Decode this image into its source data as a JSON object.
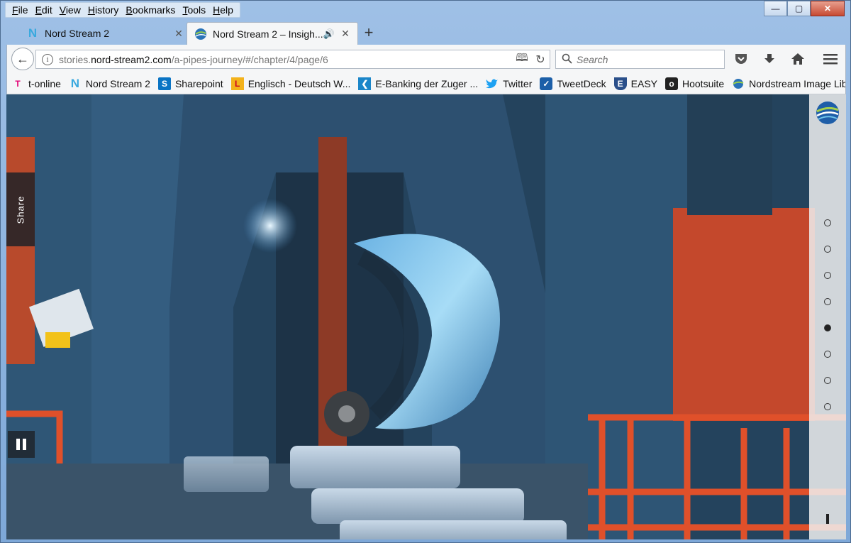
{
  "menu": [
    "File",
    "Edit",
    "View",
    "History",
    "Bookmarks",
    "Tools",
    "Help"
  ],
  "window_controls": {
    "minimize": "—",
    "maximize": "▢",
    "close": "✕"
  },
  "tabs": [
    {
      "title": "Nord Stream 2",
      "icon": "nord-stream-n-icon",
      "active": false
    },
    {
      "title": "Nord Stream 2 – Insigh...",
      "icon": "globe-logo-icon",
      "active": true,
      "audio": true
    }
  ],
  "new_tab_label": "+",
  "address": {
    "domain_prefix": "stories.",
    "domain": "nord-stream2.com",
    "path": "/a-pipes-journey/#/chapter/4/page/6"
  },
  "search": {
    "placeholder": "Search"
  },
  "bookmarks": [
    {
      "label": "t-online",
      "icon": "t-online-icon"
    },
    {
      "label": "Nord Stream 2",
      "icon": "nord-stream-n-icon"
    },
    {
      "label": "Sharepoint",
      "icon": "sharepoint-icon"
    },
    {
      "label": "Englisch - Deutsch W...",
      "icon": "leo-dictionary-icon"
    },
    {
      "label": "E-Banking der Zuger ...",
      "icon": "bank-icon"
    },
    {
      "label": "Twitter",
      "icon": "twitter-bird-icon"
    },
    {
      "label": "TweetDeck",
      "icon": "tweetdeck-icon"
    },
    {
      "label": "EASY",
      "icon": "easy-shield-icon"
    },
    {
      "label": "Hootsuite",
      "icon": "hootsuite-owl-icon"
    },
    {
      "label": "Nordstream Image Lib...",
      "icon": "globe-logo-icon"
    }
  ],
  "content": {
    "share_label": "Share",
    "page_dots": 8,
    "active_dot_index": 4,
    "colors": {
      "steel_blue": "#2b4a63",
      "orange_rail": "#e0502a",
      "pipe_highlight": "#9fd1f0"
    }
  }
}
